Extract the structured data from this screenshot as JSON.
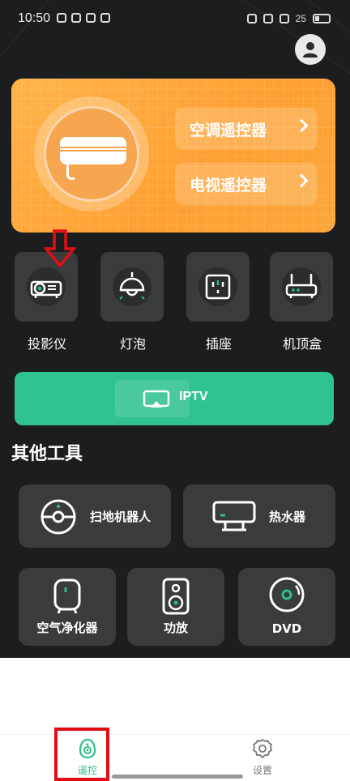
{
  "status_bar": {
    "time": "10:50",
    "battery": "25"
  },
  "hero": {
    "ac_button": "空调遥控器",
    "tv_button": "电视遥控器",
    "accent": "#ffa53b"
  },
  "devices": [
    {
      "label": "投影仪",
      "icon": "projector-icon"
    },
    {
      "label": "灯泡",
      "icon": "lamp-icon"
    },
    {
      "label": "插座",
      "icon": "socket-icon"
    },
    {
      "label": "机顶盒",
      "icon": "router-icon"
    }
  ],
  "iptv": {
    "label": "IPTV",
    "color": "#31c38f"
  },
  "other_tools": {
    "title": "其他工具",
    "items": [
      {
        "label": "扫地机器人",
        "icon": "robot-vacuum-icon"
      },
      {
        "label": "热水器",
        "icon": "water-heater-icon"
      },
      {
        "label": "空气净化器",
        "icon": "air-purifier-icon"
      },
      {
        "label": "功放",
        "icon": "speaker-icon"
      },
      {
        "label": "DVD",
        "icon": "disc-icon"
      }
    ]
  },
  "bottom_nav": {
    "remote_label": "遥控",
    "settings_label": "设置",
    "active_color": "#2ebd87"
  }
}
